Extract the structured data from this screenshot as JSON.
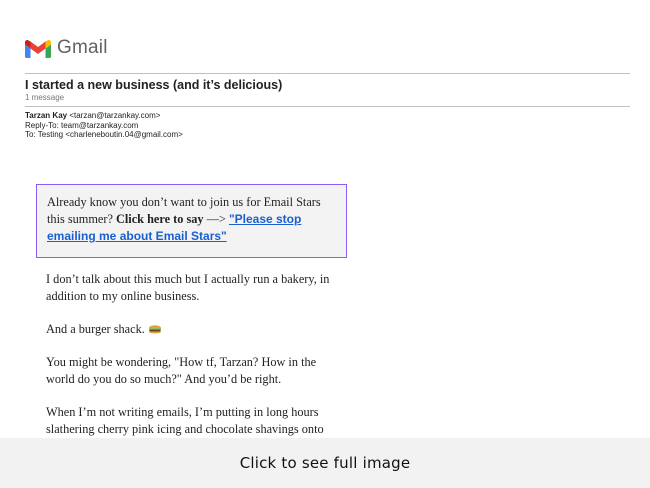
{
  "app": {
    "name": "Gmail",
    "logo_icon": "gmail-logo-icon"
  },
  "email": {
    "subject": "I started a new business (and it’s delicious)",
    "message_count": "1 message",
    "sender_name": "Tarzan Kay",
    "sender_email": "<tarzan@tarzankay.com>",
    "reply_to": "Reply-To: team@tarzankay.com",
    "to": "To: Testing <charleneboutin.04@gmail.com>"
  },
  "callout": {
    "text_before": "Already know you don’t want to join us for Email Stars this summer? ",
    "bold_text": "Click here to say",
    "arrow_text": " —> ",
    "link_text": "\"Please stop emailing me about Email Stars\""
  },
  "body": {
    "paragraphs": [
      "I don’t talk about this much but I actually run a bakery, in addition to my online business.",
      "And a burger shack.",
      "You might be wondering, \"How tf, Tarzan? How in the world do you do so much?\" And you’d be right.",
      "When I’m not writing emails, I’m putting in long hours slathering cherry pink icing and chocolate shavings onto"
    ],
    "emoji_icon": "burger-icon"
  },
  "footer": {
    "label": "Click to see full image"
  },
  "colors": {
    "callout_border": "#8b5cf6",
    "link": "#1a5fd0",
    "footer_bg": "#f2f2f2"
  }
}
